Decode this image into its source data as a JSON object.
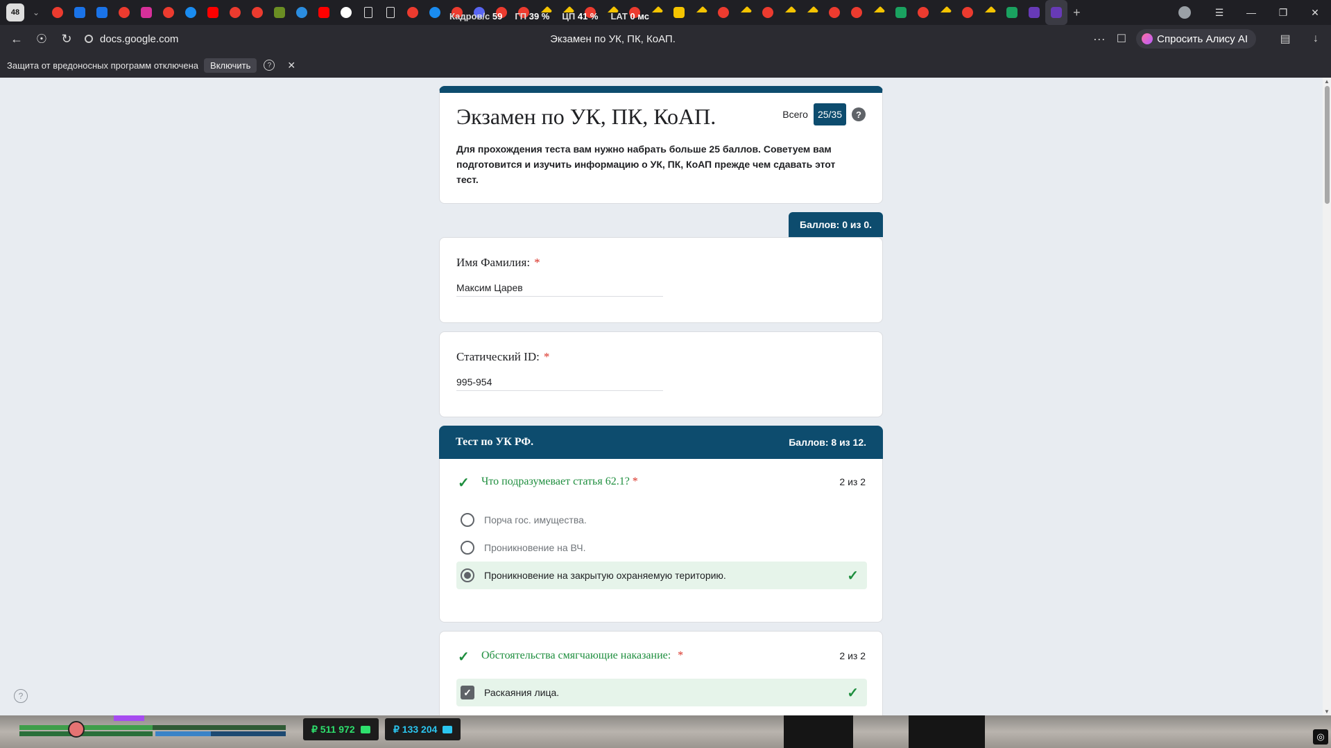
{
  "browser": {
    "tab_count": "48",
    "perf_overlay": [
      {
        "label": "Кадров/с",
        "value": "59"
      },
      {
        "label": "ГП",
        "value": "39 %"
      },
      {
        "label": "ЦП",
        "value": "41 %"
      },
      {
        "label": "LAT",
        "value": "0 мс"
      }
    ],
    "url": "docs.google.com",
    "page_title": "Экзамен по УК, ПК, КоАП.",
    "alice_label": "Спросить Алису AI",
    "notification": {
      "text": "Защита от вредоносных программ отключена",
      "enable_label": "Включить",
      "help_glyph": "?",
      "close_glyph": "✕"
    }
  },
  "form": {
    "title": "Экзамен по УК, ПК, КоАП.",
    "total_label": "Всего",
    "total_score": "25/35",
    "description": "Для прохождения теста вам нужно набрать больше 25 баллов. Советуем вам подготовится и изучить информацию о УК, ПК, КоАП прежде чем сдавать этот тест.",
    "points_tab": "Баллов: 0 из 0.",
    "fields": [
      {
        "label": "Имя Фамилия:",
        "value": "Максим Царев"
      },
      {
        "label": "Статический ID:",
        "value": "995-954"
      }
    ],
    "required_mark": "*",
    "section": {
      "title": "Тест по УК РФ.",
      "score": "Баллов: 8 из 12."
    },
    "questions": [
      {
        "text": "Что подразумевает статья 62.1?",
        "points": "2 из 2",
        "type": "radio",
        "options": [
          {
            "label": "Порча гос. имущества.",
            "selected": false,
            "correct": false
          },
          {
            "label": "Проникновение на ВЧ.",
            "selected": false,
            "correct": false
          },
          {
            "label": "Проникновение на закрытую охраняемую територию.",
            "selected": true,
            "correct": true
          }
        ]
      },
      {
        "text": "Обстоятельства смягчающие наказание:",
        "points": "2 из 2",
        "type": "checkbox",
        "options": [
          {
            "label": "Раскаяния лица.",
            "selected": true,
            "correct": true
          }
        ]
      }
    ]
  },
  "hud": {
    "cash": "₽ 511 972",
    "bank": "₽ 133 204"
  },
  "colors": {
    "accent": "#0d4c6e",
    "correct_green": "#1e8e3e",
    "correct_bg": "#e6f4ea",
    "required_red": "#d93025"
  }
}
